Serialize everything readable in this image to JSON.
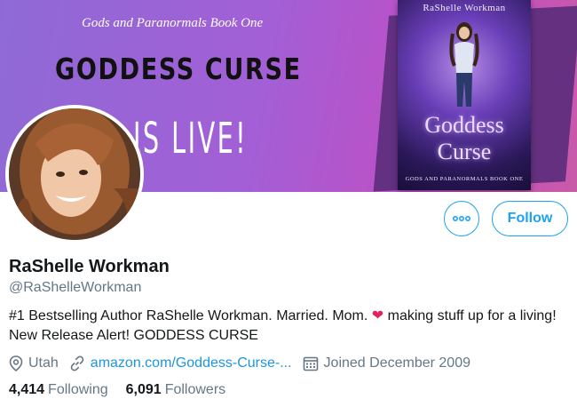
{
  "banner": {
    "series": "Gods and Paranormals Book One",
    "title": "GODDESS CURSE",
    "tagline": "IS LIVE!"
  },
  "book": {
    "author": "RaShelle Workman",
    "word1": "Goddess",
    "word2": "Curse",
    "subtitle": "GODS AND PARANORMALS BOOK ONE"
  },
  "actions": {
    "more_icon": "more-icon",
    "follow_label": "Follow"
  },
  "profile": {
    "name": "RaShelle Workman",
    "handle": "@RaShelleWorkman",
    "bio_before": "#1 Bestselling Author RaShelle Workman. Married. Mom. ",
    "bio_heart": "❤",
    "bio_after": " making stuff up for a living! New Release Alert! GODDESS CURSE"
  },
  "meta": {
    "location": "Utah",
    "link": "amazon.com/Goddess-Curse-...",
    "joined": "Joined December 2009"
  },
  "stats": {
    "following_count": "4,414",
    "following_label": "Following",
    "followers_count": "6,091",
    "followers_label": "Followers"
  },
  "colors": {
    "accent": "#1da1f2",
    "text": "#14171a",
    "secondary": "#657786",
    "heart": "#e0245e"
  }
}
